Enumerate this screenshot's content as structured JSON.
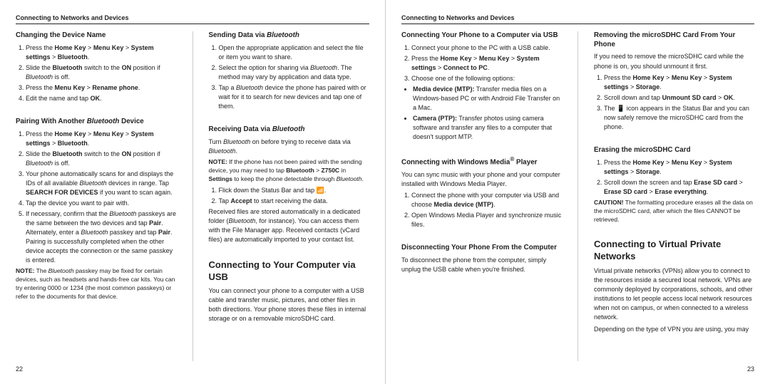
{
  "left_page": {
    "header": "Connecting to Networks and Devices",
    "page_number": "22",
    "col1": {
      "sections": [
        {
          "id": "changing-device-name",
          "title": "Changing the Device Name",
          "content_type": "ol",
          "items": [
            "Press the <b>Home Key</b> > <b>Menu Key</b> > <b>System settings</b> > <b>Bluetooth</b>.",
            "Slide the <b>Bluetooth</b> switch to the <b>ON</b> position if <em>Bluetooth</em> is off.",
            "Press the <b>Menu Key</b> > <b>Rename phone</b>.",
            "Edit the name and tap <b>OK</b>."
          ]
        },
        {
          "id": "pairing-bluetooth",
          "title": "Pairing With Another Bluetooth Device",
          "content_type": "ol",
          "items": [
            "Press the <b>Home Key</b> > <b>Menu Key</b> > <b>System settings</b> > <b>Bluetooth</b>.",
            "Slide the <b>Bluetooth</b> switch to the <b>ON</b> position if <em>Bluetooth</em> is off.",
            "Your phone automatically scans for and displays the IDs of all available <em>Bluetooth</em> devices in range. Tap <b>SEARCH FOR DEVICES</b> if you want to scan again.",
            "Tap the device you want to pair with.",
            "If necessary, confirm that the <em>Bluetooth</em> passkeys are the same between the two devices and tap <b>Pair</b>. Alternately, enter a <em>Bluetooth</em> passkey and tap <b>Pair</b>.\nPairing is successfully completed when the other device accepts the connection or the same passkey is entered."
          ],
          "note": "<b>NOTE:</b> The <em>Bluetooth</em> passkey may be fixed for certain devices, such as headsets and hands-free car kits. You can try entering 0000 or 1234 (the most common passkeys) or refer to the documents for that device."
        }
      ]
    },
    "col2": {
      "sections": [
        {
          "id": "sending-data-bluetooth",
          "title": "Sending Data via Bluetooth",
          "title_italic": "Bluetooth",
          "content_type": "ol",
          "items": [
            "Open the appropriate application and select the file or item you want to share.",
            "Select the option for sharing via <em>Bluetooth</em>. The method may vary by application and data type.",
            "Tap a <em>Bluetooth</em> device the phone has paired with or wait for it to search for new devices and tap one of them."
          ]
        },
        {
          "id": "receiving-data-bluetooth",
          "title": "Receiving Data via Bluetooth",
          "title_italic": "Bluetooth",
          "content_type": "mixed",
          "intro": "Turn <em>Bluetooth</em> on before trying to receive data via <em>Bluetooth</em>.",
          "note": "<b>NOTE:</b> If the phone has not been paired with the sending device, you may need to tap <b>Bluetooth</b> > <b>Z750C</b> in <b>Settings</b> to keep the phone detectable through <em>Bluetooth</em>.",
          "items": [
            "Flick down the Status Bar and tap &#x1F4F6;.",
            "Tap <b>Accept</b> to start receiving the data."
          ],
          "extra": "Received files are stored automatically in a dedicated folder (<em>Bluetooth</em>, for instance). You can access them with the File Manager app. Received contacts (vCard files) are automatically imported to your contact list."
        },
        {
          "id": "connecting-computer-usb",
          "title": "Connecting to Your Computer via USB",
          "content_type": "body",
          "body": "You can connect your phone to a computer with a USB cable and transfer music, pictures, and other files in both directions. Your phone stores these files in internal storage or on a removable microSDHC card."
        }
      ]
    }
  },
  "right_page": {
    "header": "Connecting to Networks and Devices",
    "page_number": "23",
    "col1": {
      "sections": [
        {
          "id": "connecting-phone-usb",
          "title": "Connecting Your Phone to a Computer via USB",
          "content_type": "ol",
          "items": [
            "Connect your phone to the PC with a USB cable.",
            "Press the <b>Home Key</b> > <b>Menu Key</b> > <b>System settings</b> > <b>Connect to PC</b>.",
            "Choose one of the following options:"
          ],
          "bullets": [
            "<b>Media device (MTP):</b> Transfer media files on a Windows-based PC or with Android File Transfer on a Mac.",
            "<b>Camera (PTP):</b> Transfer photos using camera software and transfer any files to a computer that doesn't support MTP."
          ]
        },
        {
          "id": "connecting-windows-media",
          "title": "Connecting with Windows Media® Player",
          "content_type": "mixed",
          "body": "You can sync music with your phone and your computer installed with Windows Media Player.",
          "items": [
            "Connect the phone with your computer via USB and choose <b>Media device (MTP)</b>.",
            "Open Windows Media Player and synchronize music files."
          ]
        },
        {
          "id": "disconnecting-phone",
          "title": "Disconnecting Your Phone From the Computer",
          "content_type": "body",
          "body": "To disconnect the phone from the computer, simply unplug the USB cable when you're finished."
        }
      ]
    },
    "col2": {
      "sections": [
        {
          "id": "removing-microsdHC",
          "title": "Removing the microSDHC Card From Your Phone",
          "content_type": "mixed",
          "intro": "If you need to remove the microSDHC card while the phone is on, you should unmount it first.",
          "items": [
            "Press the <b>Home Key</b> > <b>Menu Key</b> > <b>System settings</b> > <b>Storage</b>.",
            "Scroll down and tap <b>Unmount SD card</b> > <b>OK</b>.",
            "The &#x1F4F1; icon appears in the Status Bar and you can now safely remove the microSDHC card from the phone."
          ]
        },
        {
          "id": "erasing-microsdHC",
          "title": "Erasing the microSDHC Card",
          "content_type": "ol",
          "items": [
            "Press the <b>Home Key</b> > <b>Menu Key</b> > <b>System settings</b> > <b>Storage</b>.",
            "Scroll down the screen and tap <b>Erase SD card</b> > <b>Erase SD card</b> > <b>Erase everything</b>."
          ],
          "caution": "<b>CAUTION!</b> The formatting procedure erases all the data on the microSDHC card, after which the files CANNOT be retrieved."
        },
        {
          "id": "connecting-vpn",
          "title": "Connecting to Virtual Private Networks",
          "large": true,
          "content_type": "body",
          "body": "Virtual private networks (VPNs) allow you to connect to the resources inside a secured local network. VPNs are commonly deployed by corporations, schools, and other institutions to let people access local network resources when not on campus, or when connected to a wireless network.\n\nDepending on the type of VPN you are using, you may"
        }
      ]
    }
  }
}
